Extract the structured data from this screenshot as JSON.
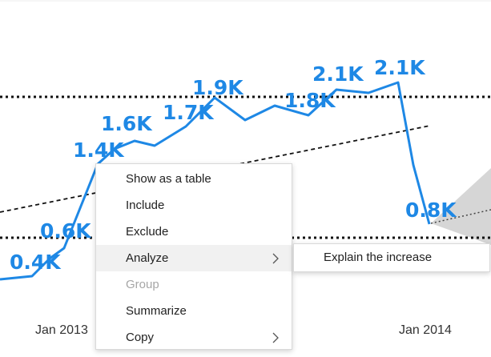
{
  "chart_data": {
    "type": "line",
    "x_ticks": [
      "Jan 2013",
      "Jan 2014"
    ],
    "data_labels": [
      "0.4K",
      "0.6K",
      "1.4K",
      "1.6K",
      "1.7K",
      "1.9K",
      "1.8K",
      "2.1K",
      "2.1K",
      "0.8K"
    ],
    "values": [
      0.4,
      0.6,
      1.4,
      1.6,
      1.7,
      1.9,
      1.8,
      2.1,
      2.1,
      0.8
    ],
    "reference_lines": [
      "upper",
      "lower"
    ],
    "trend_line": "dashed",
    "forecast": "shaded cone",
    "colors": {
      "series": "#1e88e5",
      "reference": "#111111",
      "forecast": "#d6d6d6"
    }
  },
  "context_menu": {
    "items": [
      {
        "label": "Show as a table",
        "state": "normal"
      },
      {
        "label": "Include",
        "state": "normal"
      },
      {
        "label": "Exclude",
        "state": "normal"
      },
      {
        "label": "Analyze",
        "state": "hovered",
        "submenu": true
      },
      {
        "label": "Group",
        "state": "disabled"
      },
      {
        "label": "Summarize",
        "state": "normal"
      },
      {
        "label": "Copy",
        "state": "normal",
        "submenu": true
      }
    ]
  },
  "submenu": {
    "items": [
      {
        "label": "Explain the increase"
      }
    ]
  }
}
